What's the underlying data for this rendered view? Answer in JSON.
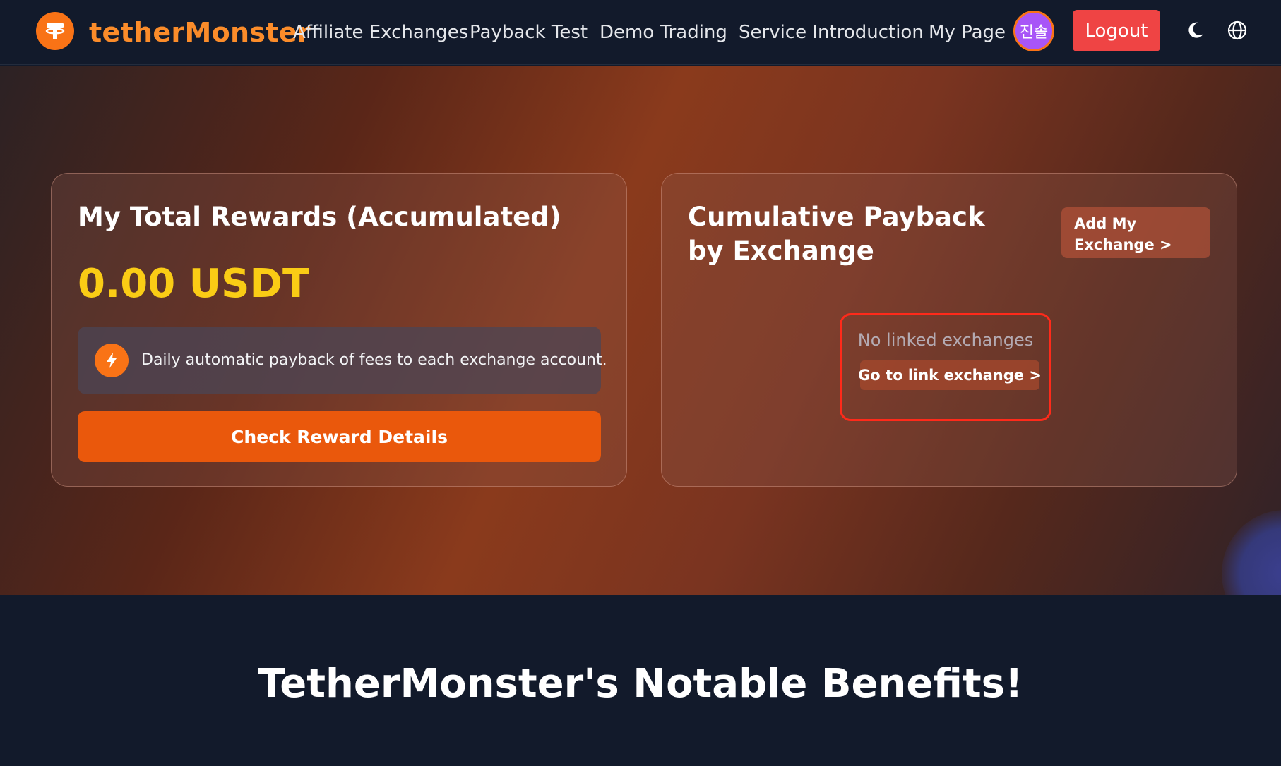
{
  "nav": {
    "brand": "tetherMonster",
    "links": [
      "Affiliate Exchanges",
      "Payback Test",
      "Demo Trading",
      "Service Introduction",
      "My Page"
    ],
    "avatar_text": "진솔",
    "logout_label": "Logout",
    "theme_icon": "moon-icon",
    "language_icon": "globe-icon"
  },
  "rewards_card": {
    "title": "My Total Rewards (Accumulated)",
    "amount": "0.00 USDT",
    "info_text": "Daily automatic payback of fees to each exchange account.",
    "button_label": "Check Reward Details"
  },
  "payback_card": {
    "title": "Cumulative Payback by Exchange",
    "add_button_label": "Add My Exchange >",
    "empty_text": "No linked exchanges",
    "link_button_label": "Go to link exchange >"
  },
  "benefits": {
    "title": "TetherMonster's Notable Benefits!"
  },
  "colors": {
    "brand_orange": "#f97316",
    "logout_red": "#ef4444",
    "amount_yellow": "#facc15",
    "highlight_red": "#ff2a1a",
    "nav_bg": "#121a2b"
  }
}
